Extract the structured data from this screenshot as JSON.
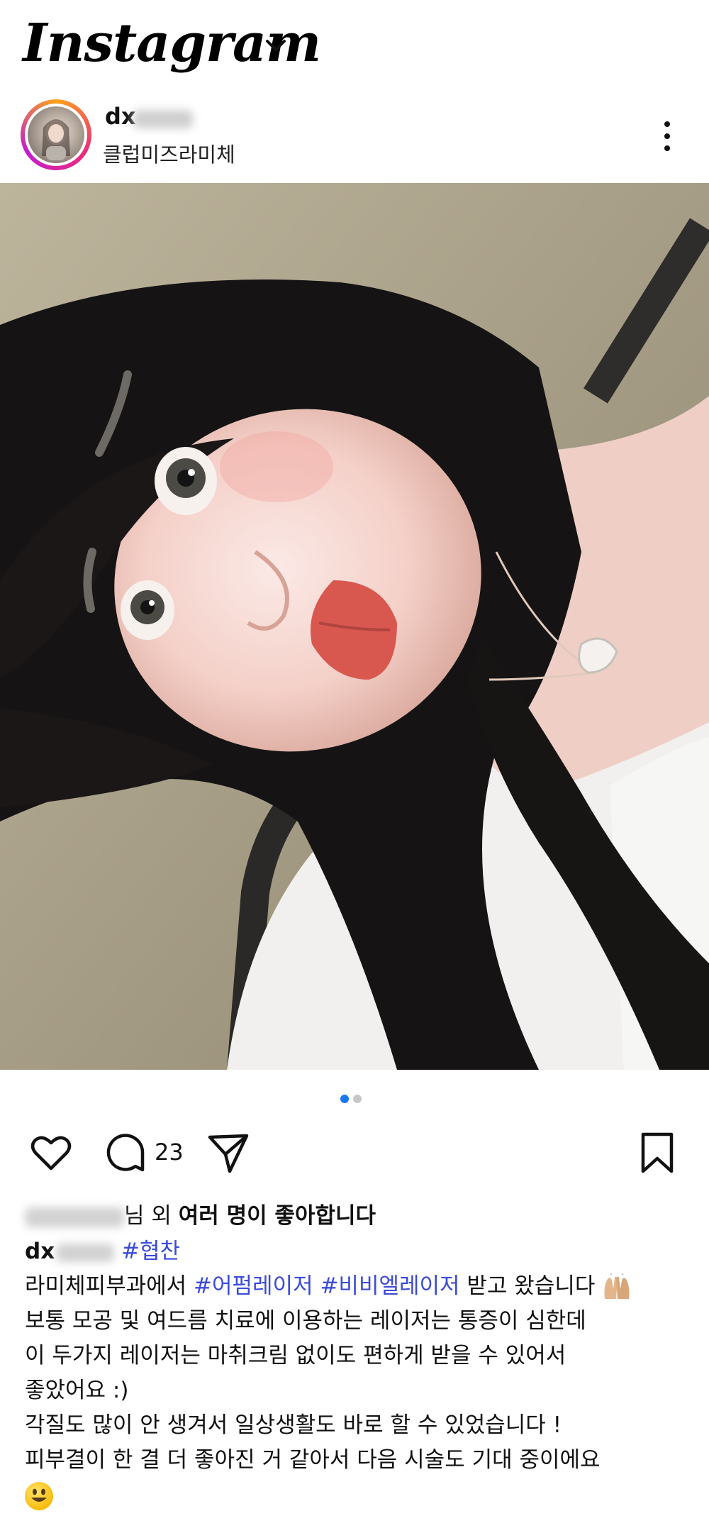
{
  "header": {
    "logo": "Instagram"
  },
  "post": {
    "username": "dx",
    "location": "클럽미즈라미체"
  },
  "carousel": {
    "count": 2,
    "active": 0
  },
  "actions": {
    "comment_count": "23"
  },
  "likes": {
    "text_suffix": "님 외",
    "text_bold": "여러 명이 좋아합니다"
  },
  "caption": {
    "user": "dx",
    "tag1": "#협찬",
    "line1_a": "라미체피부과에서 ",
    "line1_tag1": "#어펌레이저",
    "line1_tag2": "#비비엘레이저",
    "line1_b": " 받고 왔습니다",
    "line2": "보통 모공 및 여드름 치료에 이용하는 레이저는 통증이 심한데",
    "line3": "이 두가지 레이저는 마취크림 없이도 편하게 받을 수 있어서",
    "line4": "좋았어요 :)",
    "line5": "각질도 많이 안 생겨서 일상생활도 바로 할 수 있었습니다 !",
    "line6": "피부결이 한 결 더 좋아진 거 같아서 다음 시술도 기대 중이에요"
  }
}
